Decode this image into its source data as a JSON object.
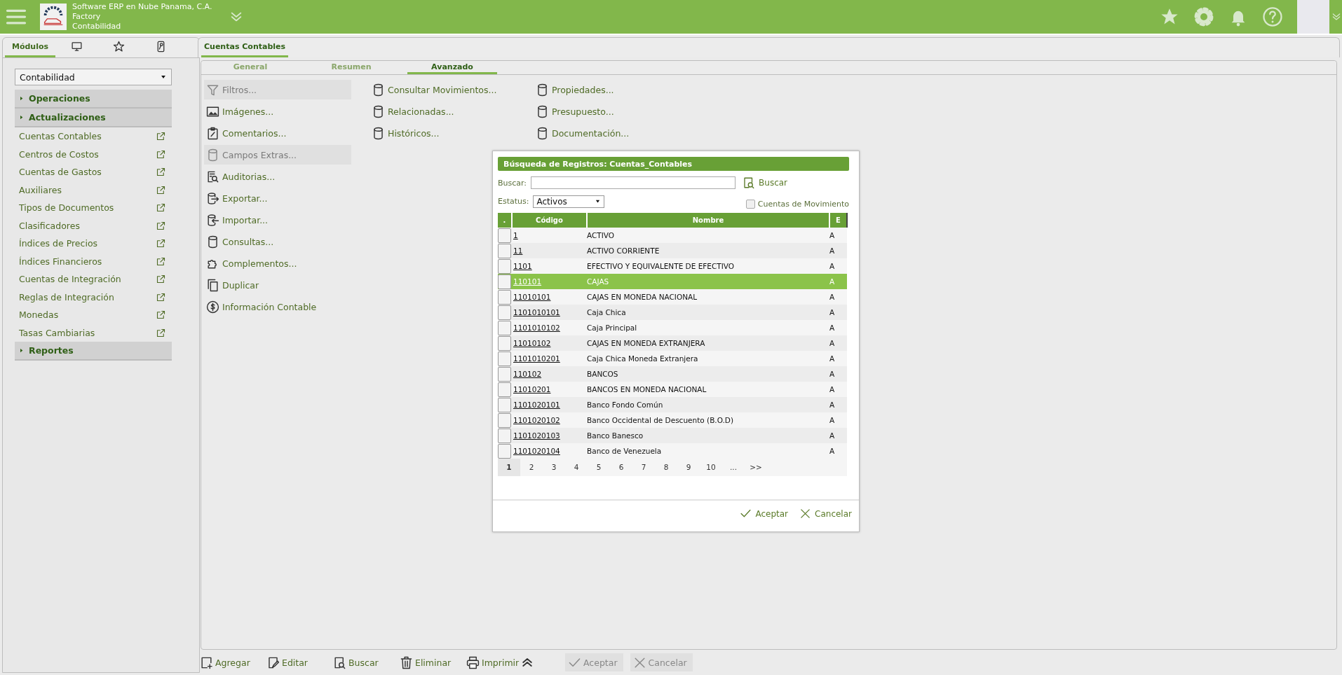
{
  "header": {
    "company": "Software ERP en Nube Panama, C.A.",
    "line_2": "Factory",
    "line_3": "Contabilidad"
  },
  "sidebar": {
    "tabs": [
      {
        "kind": "text",
        "label": "Módulos",
        "selected": true
      },
      {
        "kind": "monitor",
        "selected": false
      },
      {
        "kind": "star",
        "selected": false
      },
      {
        "kind": "keycard",
        "selected": false
      }
    ],
    "module_select": {
      "value": "Contabilidad"
    },
    "sections": [
      {
        "label": "Operaciones"
      },
      {
        "label": "Actualizaciones",
        "items": [
          "Cuentas Contables",
          "Centros de Costos",
          "Cuentas de Gastos",
          "Auxiliares",
          "Tipos de Documentos",
          "Clasificadores",
          "Índices de Precios",
          "Índices Financieros",
          "Cuentas de Integración",
          "Reglas de Integración",
          "Monedas",
          "Tasas Cambiarias"
        ]
      },
      {
        "label": "Reportes"
      }
    ]
  },
  "main_tabs": [
    {
      "label": "Cuentas Contables",
      "selected": true
    }
  ],
  "subtabs": [
    {
      "label": "General",
      "selected": false
    },
    {
      "label": "Resumen",
      "selected": false
    },
    {
      "label": "Avanzado",
      "selected": true
    }
  ],
  "action_columns": [
    {
      "items": [
        {
          "label": "Filtros...",
          "kind": "filter",
          "disabled": true
        },
        {
          "label": "Imágenes...",
          "kind": "image",
          "disabled": false
        },
        {
          "label": "Comentarios...",
          "kind": "clipboard",
          "disabled": false
        },
        {
          "label": "Campos Extras...",
          "kind": "database",
          "disabled": true
        },
        {
          "label": "Auditorias...",
          "kind": "audit",
          "disabled": false
        },
        {
          "label": "Exportar...",
          "kind": "export",
          "disabled": false
        },
        {
          "label": "Importar...",
          "kind": "import",
          "disabled": false
        },
        {
          "label": "Consultas...",
          "kind": "database",
          "disabled": false
        },
        {
          "label": "Complementos...",
          "kind": "puzzle",
          "disabled": false
        },
        {
          "label": "Duplicar",
          "kind": "copy",
          "disabled": false
        },
        {
          "label": "Información Contable",
          "kind": "dollar",
          "disabled": false
        }
      ]
    },
    {
      "items": [
        {
          "label": "Consultar Movimientos...",
          "kind": "database",
          "disabled": false
        },
        {
          "label": "Relacionadas...",
          "kind": "database",
          "disabled": false
        },
        {
          "label": "Históricos...",
          "kind": "database",
          "disabled": false
        }
      ]
    },
    {
      "items": [
        {
          "label": "Propiedades...",
          "kind": "database",
          "disabled": false
        },
        {
          "label": "Presupuesto...",
          "kind": "database",
          "disabled": false
        },
        {
          "label": "Documentación...",
          "kind": "database",
          "disabled": false
        }
      ]
    }
  ],
  "dialog": {
    "title": "Búsqueda de Registros: Cuentas_Contables",
    "search_label": "Buscar:",
    "search_button": "Buscar",
    "status_label": "Estatus:",
    "status_value": "Activos",
    "movement_checkbox": {
      "label": "Cuentas de Movimiento",
      "checked": false
    },
    "columns": [
      ".",
      "Código",
      "Nombre",
      "E"
    ],
    "rows": [
      {
        "code": "1",
        "name": "ACTIVO",
        "e": "A",
        "selected": false
      },
      {
        "code": "11",
        "name": "ACTIVO CORRIENTE",
        "e": "A",
        "selected": false
      },
      {
        "code": "1101",
        "name": "EFECTIVO Y EQUIVALENTE DE EFECTIVO",
        "e": "A",
        "selected": false
      },
      {
        "code": "110101",
        "name": "CAJAS",
        "e": "A",
        "selected": true
      },
      {
        "code": "11010101",
        "name": "CAJAS EN MONEDA NACIONAL",
        "e": "A",
        "selected": false
      },
      {
        "code": "1101010101",
        "name": "Caja Chica",
        "e": "A",
        "selected": false
      },
      {
        "code": "1101010102",
        "name": "Caja Principal",
        "e": "A",
        "selected": false
      },
      {
        "code": "11010102",
        "name": "CAJAS EN MONEDA EXTRANJERA",
        "e": "A",
        "selected": false
      },
      {
        "code": "1101010201",
        "name": "Caja Chica Moneda Extranjera",
        "e": "A",
        "selected": false
      },
      {
        "code": "110102",
        "name": "BANCOS",
        "e": "A",
        "selected": false
      },
      {
        "code": "11010201",
        "name": "BANCOS EN MONEDA NACIONAL",
        "e": "A",
        "selected": false
      },
      {
        "code": "1101020101",
        "name": "Banco Fondo Común",
        "e": "A",
        "selected": false
      },
      {
        "code": "1101020102",
        "name": "Banco Occidental de Descuento (B.O.D)",
        "e": "A",
        "selected": false
      },
      {
        "code": "1101020103",
        "name": "Banco Banesco",
        "e": "A",
        "selected": false
      },
      {
        "code": "1101020104",
        "name": "Banco de Venezuela",
        "e": "A",
        "selected": false
      }
    ],
    "pages": [
      {
        "label": "1",
        "selected": true
      },
      {
        "label": "2",
        "selected": false
      },
      {
        "label": "3",
        "selected": false
      },
      {
        "label": "4",
        "selected": false
      },
      {
        "label": "5",
        "selected": false
      },
      {
        "label": "6",
        "selected": false
      },
      {
        "label": "7",
        "selected": false
      },
      {
        "label": "8",
        "selected": false
      },
      {
        "label": "9",
        "selected": false
      },
      {
        "label": "10",
        "selected": false
      },
      {
        "label": "...",
        "selected": false
      },
      {
        "label": ">>",
        "selected": false
      }
    ],
    "buttons": [
      {
        "label": "Aceptar",
        "kind": "accept"
      },
      {
        "label": "Cancelar",
        "kind": "cancel"
      }
    ]
  },
  "toolbar": [
    {
      "label": "Agregar",
      "kind": "add",
      "disabled": false
    },
    {
      "label": "Editar",
      "kind": "edit",
      "disabled": false
    },
    {
      "label": "Buscar",
      "kind": "search",
      "disabled": false
    },
    {
      "label": "Eliminar",
      "kind": "delete",
      "disabled": false
    },
    {
      "label": "Imprimir",
      "kind": "print",
      "disabled": false
    },
    {
      "kind": "collapse",
      "disabled": false
    },
    {
      "label": "Aceptar",
      "kind": "accept",
      "disabled": true
    },
    {
      "label": "Cancelar",
      "kind": "cancel",
      "disabled": true
    }
  ]
}
